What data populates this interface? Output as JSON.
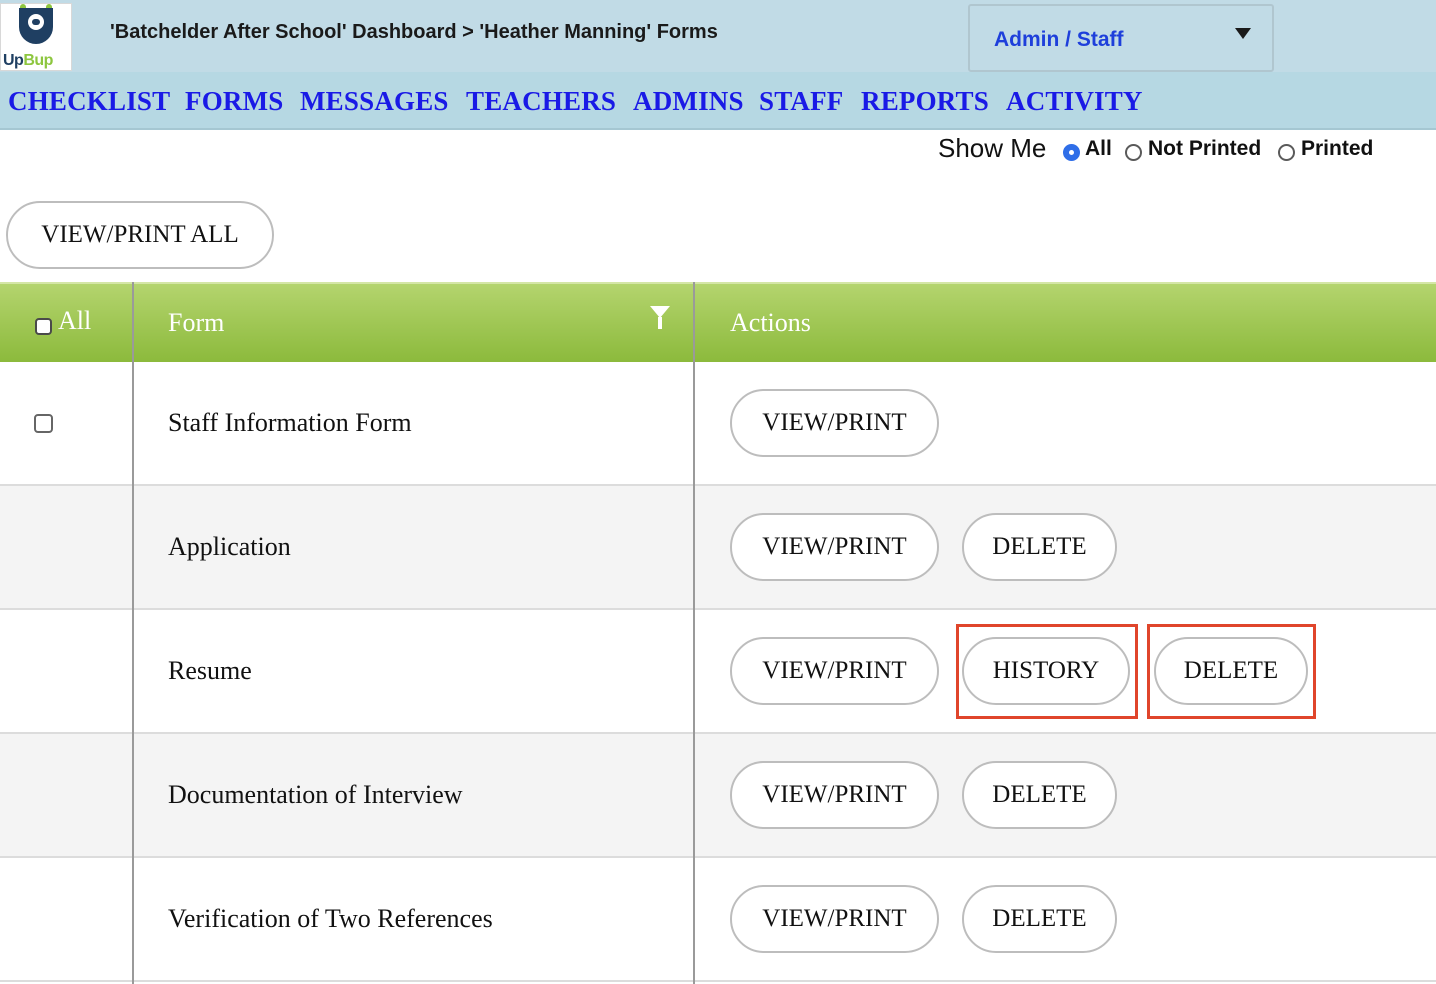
{
  "header": {
    "logo_text_up": "Up",
    "logo_text_bup": "Bup",
    "breadcrumb": "'Batchelder After School' Dashboard > 'Heather Manning' Forms",
    "role_selected": "Admin / Staff"
  },
  "nav": [
    "CHECKLIST",
    "FORMS",
    "MESSAGES",
    "TEACHERS",
    "ADMINS",
    "STAFF",
    "REPORTS",
    "ACTIVITY"
  ],
  "filter": {
    "label": "Show Me",
    "options": [
      "All",
      "Not Printed",
      "Printed"
    ],
    "selected": "All"
  },
  "view_print_all_label": "VIEW/PRINT ALL",
  "table": {
    "headers": {
      "all": "All",
      "form": "Form",
      "actions": "Actions"
    },
    "rows": [
      {
        "form": "Staff Information Form",
        "actions": [
          "VIEW/PRINT"
        ]
      },
      {
        "form": "Application",
        "actions": [
          "VIEW/PRINT",
          "DELETE"
        ]
      },
      {
        "form": "Resume",
        "actions": [
          "VIEW/PRINT",
          "HISTORY",
          "DELETE"
        ]
      },
      {
        "form": "Documentation of Interview",
        "actions": [
          "VIEW/PRINT",
          "DELETE"
        ]
      },
      {
        "form": "Verification of Two References",
        "actions": [
          "VIEW/PRINT",
          "DELETE"
        ]
      }
    ]
  },
  "colors": {
    "header_bg": "#c1dbe6",
    "nav_link": "#1a1ae6",
    "table_header": "#9cc54d",
    "highlight": "#e0452b"
  }
}
